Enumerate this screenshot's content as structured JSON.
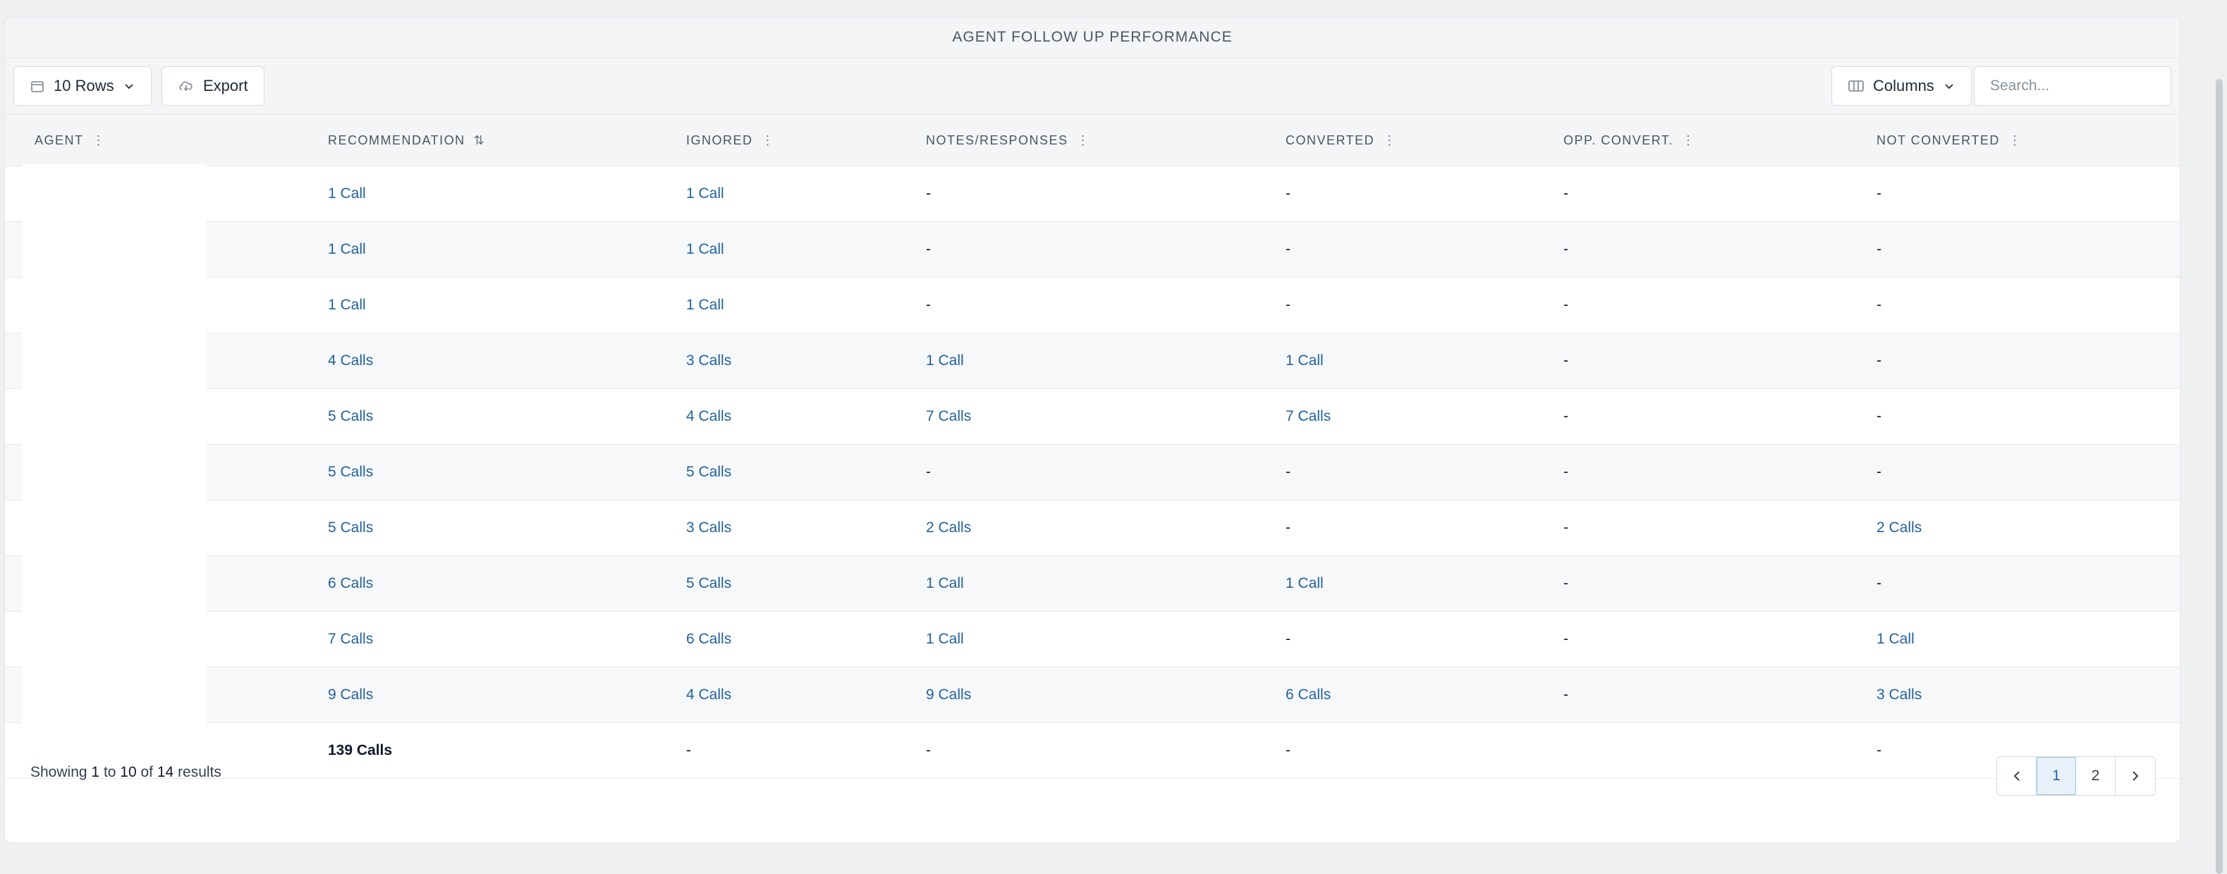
{
  "header": {
    "title": "AGENT FOLLOW UP PERFORMANCE"
  },
  "toolbar": {
    "rows_label": "10 Rows",
    "export_label": "Export",
    "columns_label": "Columns",
    "search_placeholder": "Search..."
  },
  "columns": [
    "AGENT",
    "RECOMMENDATION",
    "IGNORED",
    "NOTES/RESPONSES",
    "CONVERTED",
    "OPP. CONVERT.",
    "NOT CONVERTED"
  ],
  "rows": [
    [
      "1 Call",
      "1 Call",
      "-",
      "-",
      "-",
      "-"
    ],
    [
      "1 Call",
      "1 Call",
      "-",
      "-",
      "-",
      "-"
    ],
    [
      "1 Call",
      "1 Call",
      "-",
      "-",
      "-",
      "-"
    ],
    [
      "4 Calls",
      "3 Calls",
      "1 Call",
      "1 Call",
      "-",
      "-"
    ],
    [
      "5 Calls",
      "4 Calls",
      "7 Calls",
      "7 Calls",
      "-",
      "-"
    ],
    [
      "5 Calls",
      "5 Calls",
      "-",
      "-",
      "-",
      "-"
    ],
    [
      "5 Calls",
      "3 Calls",
      "2 Calls",
      "-",
      "-",
      "2 Calls"
    ],
    [
      "6 Calls",
      "5 Calls",
      "1 Call",
      "1 Call",
      "-",
      "-"
    ],
    [
      "7 Calls",
      "6 Calls",
      "1 Call",
      "-",
      "-",
      "1 Call"
    ],
    [
      "9 Calls",
      "4 Calls",
      "9 Calls",
      "6 Calls",
      "-",
      "3 Calls"
    ]
  ],
  "totals": [
    "139 Calls",
    "-",
    "-",
    "-",
    "",
    "-"
  ],
  "footer": {
    "showing_prefix": "Showing",
    "from": "1",
    "to_word": "to",
    "to": "10",
    "of_word": "of",
    "total": "14",
    "results_word": "results"
  },
  "pagination": {
    "pages": [
      "1",
      "2"
    ],
    "current": "1"
  }
}
